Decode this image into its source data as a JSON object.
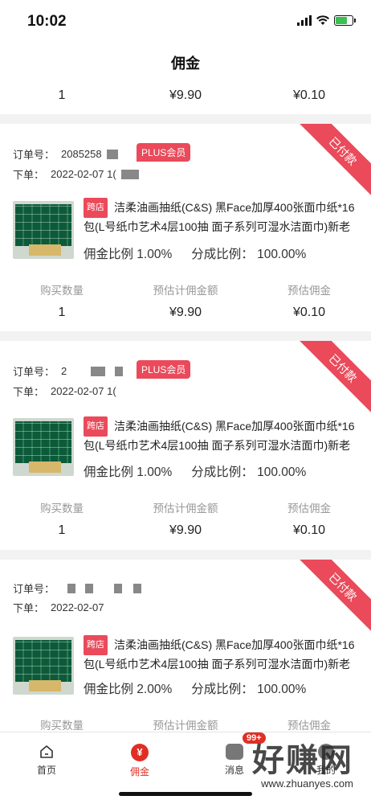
{
  "status_bar": {
    "time": "10:02"
  },
  "nav": {
    "title": "佣金"
  },
  "partial_card": {
    "quantity": "1",
    "estimated_amount": "¥9.90",
    "estimated_commission": "¥0.10"
  },
  "column_headers": {
    "quantity": "购买数量",
    "estimated_amount": "预估计佣金额",
    "estimated_commission": "预估佣金"
  },
  "orders": [
    {
      "status": "已付款",
      "order_label": "订单号：",
      "order_no_visible": "2085258",
      "plus_badge": "PLUS会员",
      "place_label": "下单：",
      "place_time": "2022-02-07 1(",
      "tag": "跨店",
      "title": "洁柔油画抽纸(C&S) 黑Face加厚400张面巾纸*16包(L号纸巾艺术4层100抽 面子系列可湿水洁面巾)新老品交...",
      "commission_rate": "佣金比例 1.00%",
      "share_rate": "分成比例：  100.00%",
      "quantity": "1",
      "estimated_amount": "¥9.90",
      "estimated_commission": "¥0.10"
    },
    {
      "status": "已付款",
      "order_label": "订单号：",
      "order_no_visible": "2",
      "plus_badge": "PLUS会员",
      "place_label": "下单：",
      "place_time": "2022-02-07 1(",
      "tag": "跨店",
      "title": "洁柔油画抽纸(C&S) 黑Face加厚400张面巾纸*16包(L号纸巾艺术4层100抽 面子系列可湿水洁面巾)新老品交...",
      "commission_rate": "佣金比例 1.00%",
      "share_rate": "分成比例：  100.00%",
      "quantity": "1",
      "estimated_amount": "¥9.90",
      "estimated_commission": "¥0.10"
    },
    {
      "status": "已付款",
      "order_label": "订单号：",
      "order_no_visible": "",
      "plus_badge": "",
      "place_label": "下单：",
      "place_time": "2022-02-07",
      "tag": "跨店",
      "title": "洁柔油画抽纸(C&S) 黑Face加厚400张面巾纸*16包(L号纸巾艺术4层100抽 面子系列可湿水洁面巾)新老品交...",
      "commission_rate": "佣金比例 2.00%",
      "share_rate": "分成比例：  100.00%"
    }
  ],
  "tab_bar": {
    "home": "首页",
    "commission": "佣金",
    "messages": "消息",
    "message_badge": "99+",
    "mine": "我的",
    "yen_symbol": "¥"
  },
  "watermark": {
    "main": "好赚网",
    "sub": "www.zhuanyes.com"
  }
}
